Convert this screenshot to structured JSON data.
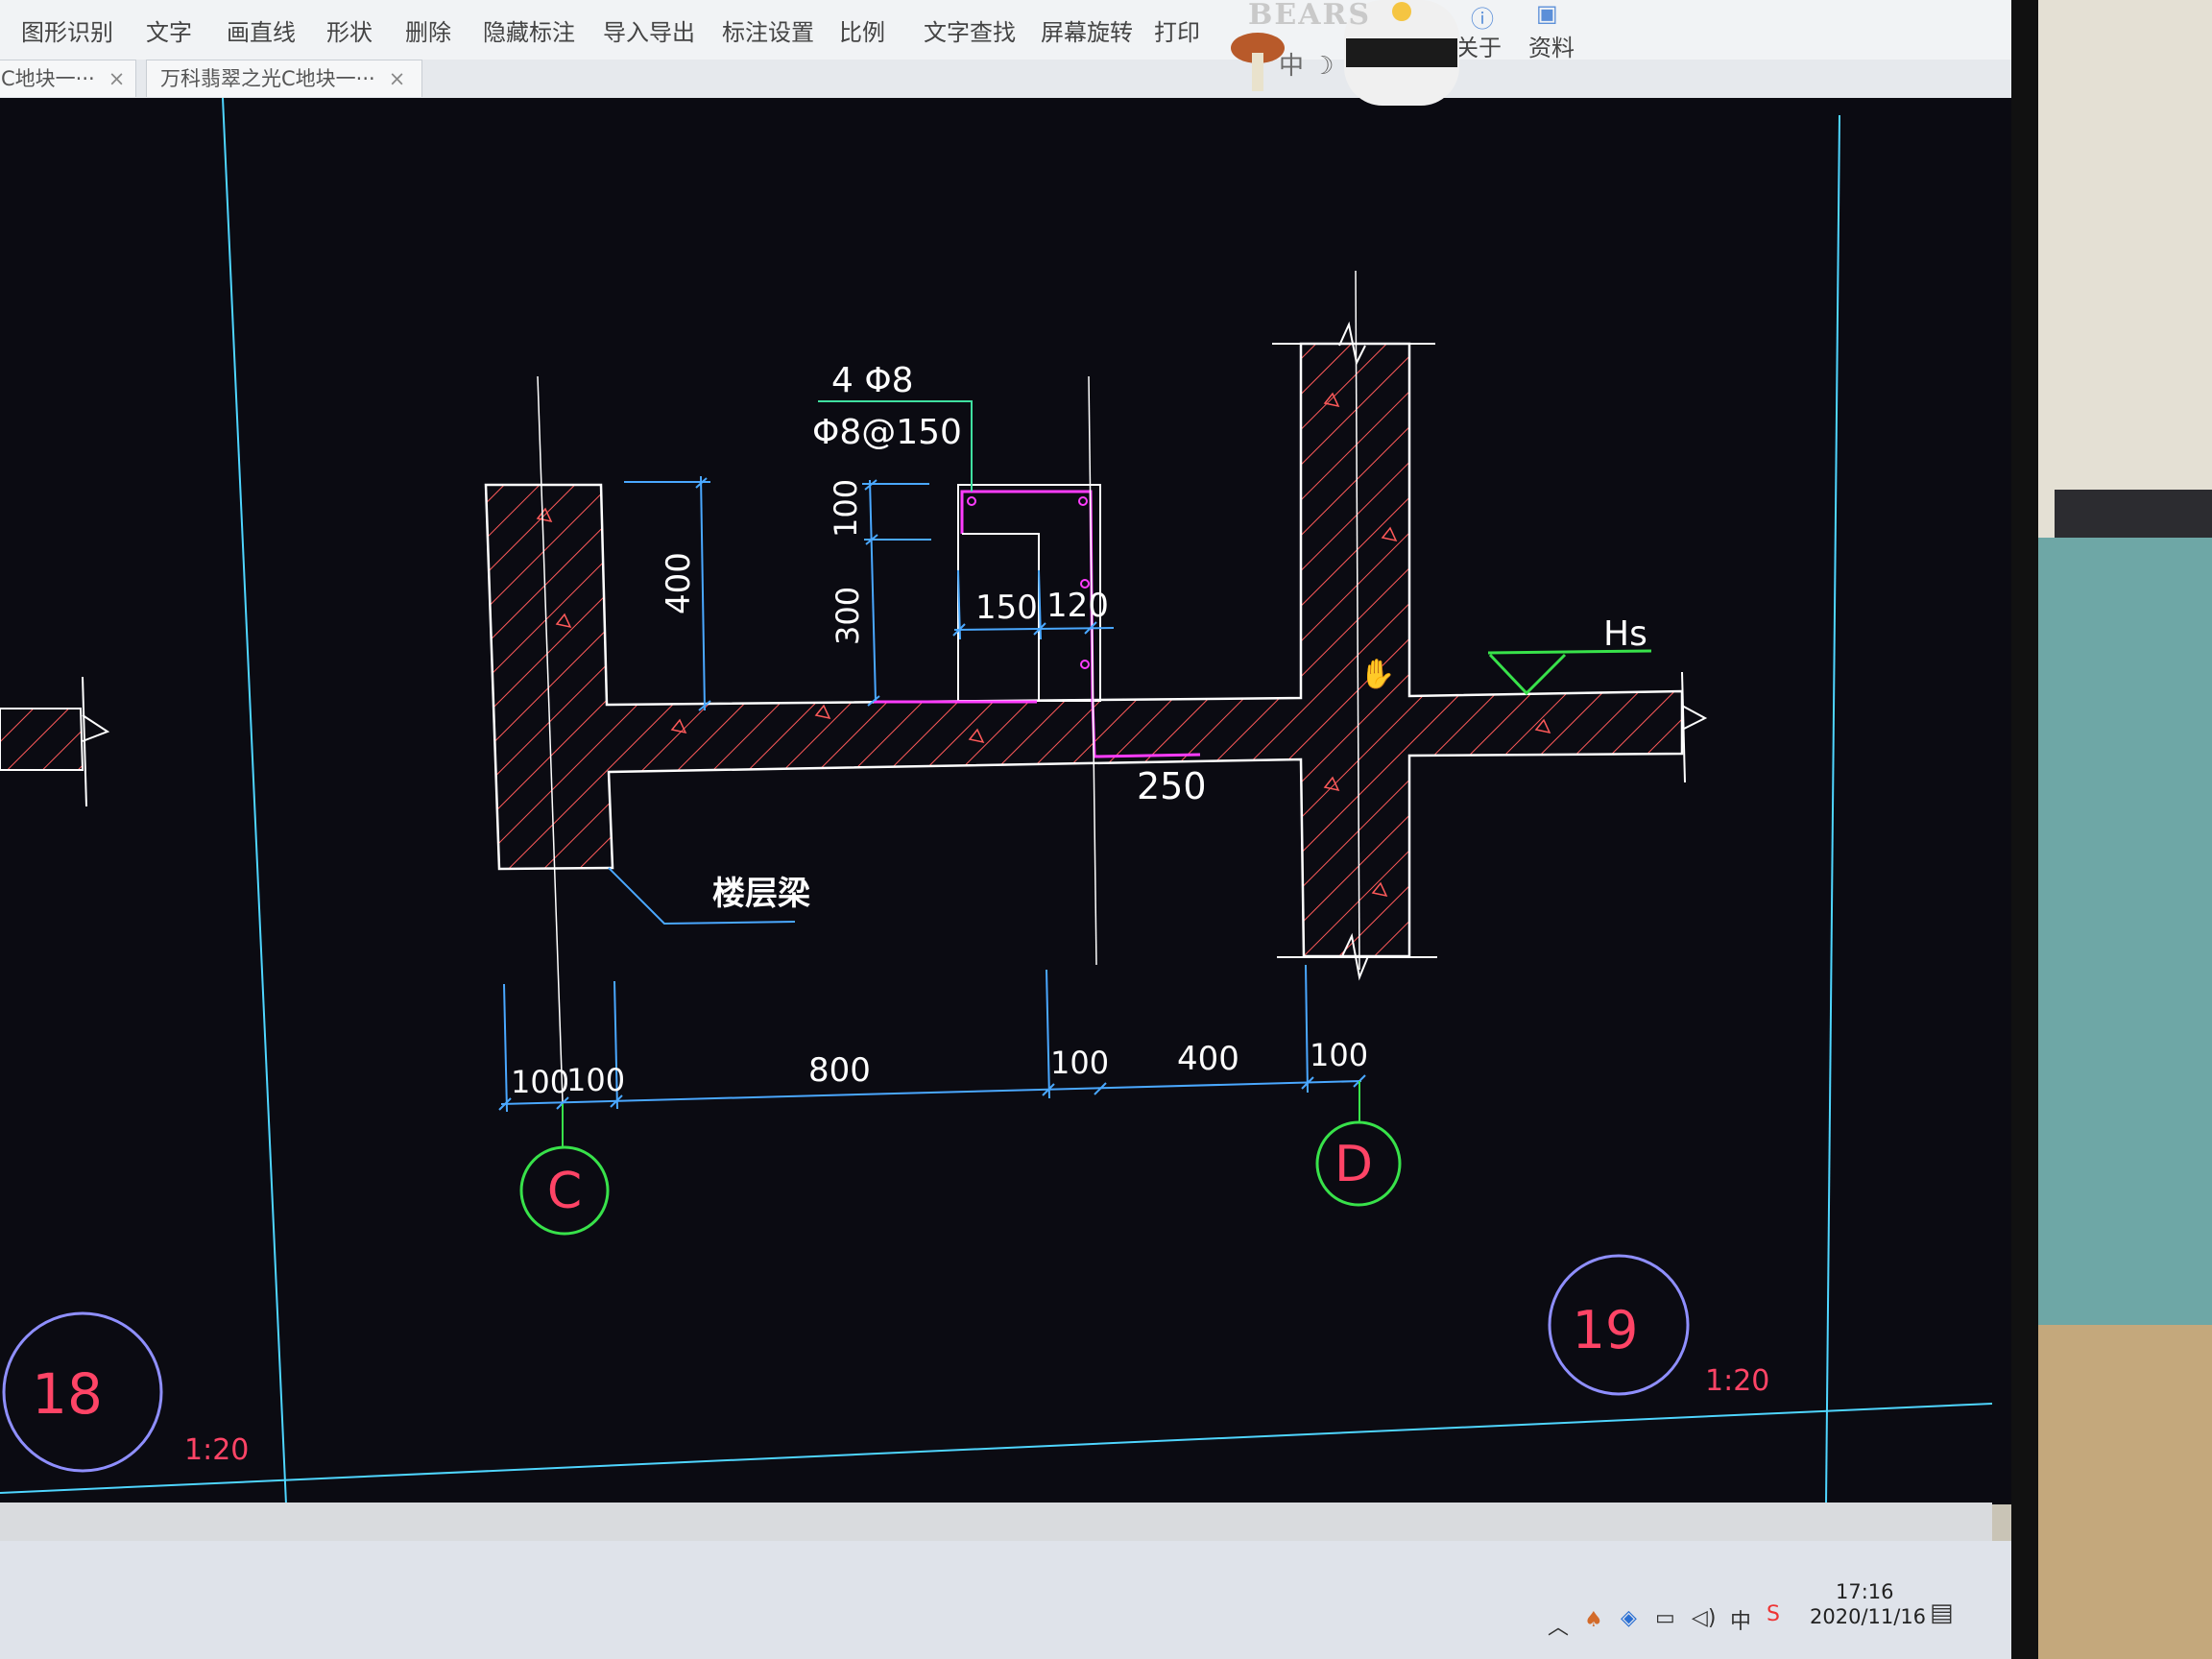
{
  "toolbar": {
    "items": [
      {
        "label": "图形识别"
      },
      {
        "label": "文字"
      },
      {
        "label": "画直线"
      },
      {
        "label": "形状"
      },
      {
        "label": "删除"
      },
      {
        "label": "隐藏标注"
      },
      {
        "label": "导入导出"
      },
      {
        "label": "标注设置"
      },
      {
        "label": "比例"
      },
      {
        "label": "文字查找"
      },
      {
        "label": "屏幕旋转"
      },
      {
        "label": "打印"
      },
      {
        "label": "关于"
      },
      {
        "label": "资料"
      }
    ]
  },
  "tabs": [
    {
      "label": "C地块一···"
    },
    {
      "label": "万科翡翠之光C地块一···"
    }
  ],
  "overlay": {
    "brand": "BEARS",
    "ime": "中 ☽"
  },
  "drawing": {
    "rebar_main": "4 Φ8",
    "rebar_stirrup": "Φ8@150",
    "dim_100_top": "100",
    "dim_300": "300",
    "dim_400_left": "400",
    "dim_150": "150",
    "dim_120": "120",
    "dim_250": "250",
    "beam_label": "楼层梁",
    "level_mark": "Hs",
    "bottom_dims": [
      "100",
      "100",
      "800",
      "100",
      "400",
      "100"
    ],
    "axis_left": "C",
    "axis_right": "D",
    "detail_18": "18",
    "detail_19": "19",
    "scale_18": "1:20",
    "scale_19": "1:20"
  },
  "taskbar": {
    "ime": "中",
    "time": "17:16",
    "date": "2020/11/16"
  },
  "colors": {
    "canvas": "#0b0b12",
    "cad_white": "#ffffff",
    "cad_red_hatch": "#ff5a5a",
    "cad_magenta": "#ff3cff",
    "cad_cyan": "#4fd6ff",
    "cad_dim_blue": "#4aa8ff",
    "cad_green": "#38e24a",
    "cad_axis_red": "#ff4466",
    "cad_circle_blue": "#8f8fff"
  }
}
